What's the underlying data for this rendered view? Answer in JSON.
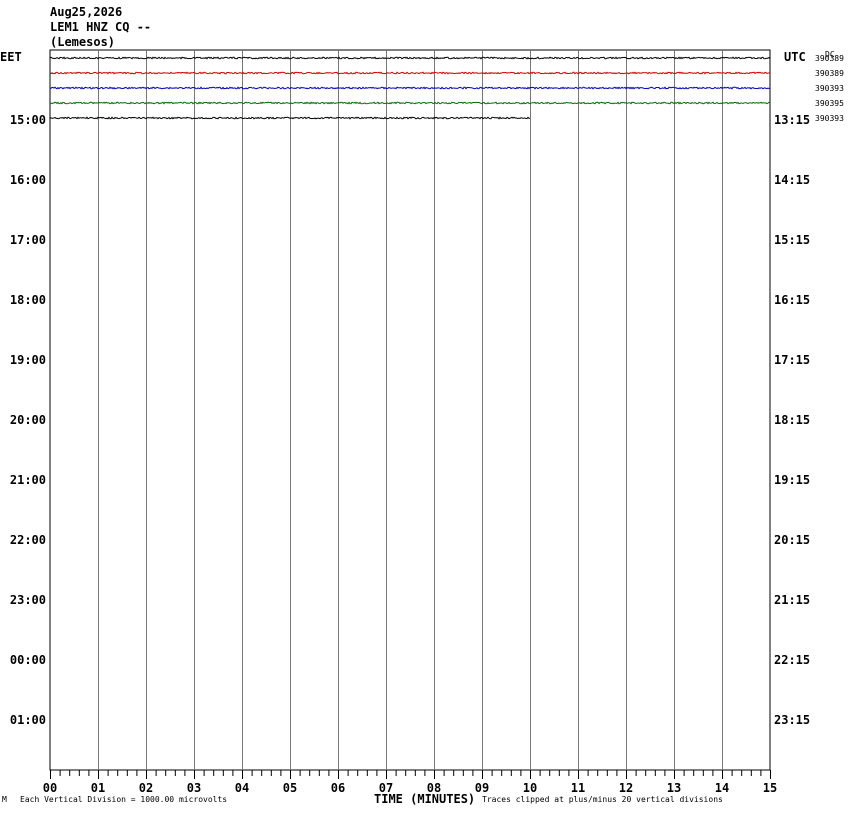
{
  "header": {
    "date": "Aug25,2026",
    "station": "LEM1 HNZ CQ --",
    "location": "(Lemesos)"
  },
  "axes": {
    "left_timezone": "EET",
    "right_timezone": "UTC",
    "right_corner_label": "DC"
  },
  "footer": {
    "corner_mark": "M",
    "scale_note": "Each Vertical Division = 1000.00 microvolts",
    "clip_note": "Traces clipped at plus/minus 20 vertical divisions"
  },
  "chart_data": {
    "type": "line",
    "title": "",
    "xlabel": "TIME (MINUTES)",
    "ylabel": "",
    "xlim": [
      0,
      15
    ],
    "x_ticks": [
      "00",
      "01",
      "02",
      "03",
      "04",
      "05",
      "06",
      "07",
      "08",
      "09",
      "10",
      "11",
      "12",
      "13",
      "14",
      "15"
    ],
    "left_hour_labels": [
      "15:00",
      "16:00",
      "17:00",
      "18:00",
      "19:00",
      "20:00",
      "21:00",
      "22:00",
      "23:00",
      "00:00",
      "01:00"
    ],
    "right_hour_labels": [
      "13:15",
      "14:15",
      "15:15",
      "16:15",
      "17:15",
      "18:15",
      "19:15",
      "20:15",
      "21:15",
      "22:15",
      "23:15"
    ],
    "grid": true,
    "series": [
      {
        "row": 0,
        "start_min": 0,
        "end_min": 15,
        "color": "#000000",
        "dc_offset": "390389"
      },
      {
        "row": 1,
        "start_min": 0,
        "end_min": 15,
        "color": "#d00000",
        "dc_offset": "390389"
      },
      {
        "row": 2,
        "start_min": 0,
        "end_min": 15,
        "color": "#0000c0",
        "dc_offset": "390393"
      },
      {
        "row": 3,
        "start_min": 0,
        "end_min": 15,
        "color": "#007000",
        "dc_offset": "390395"
      },
      {
        "row": 4,
        "start_min": 0,
        "end_min": 10,
        "color": "#000000",
        "dc_offset": "390393"
      }
    ]
  }
}
